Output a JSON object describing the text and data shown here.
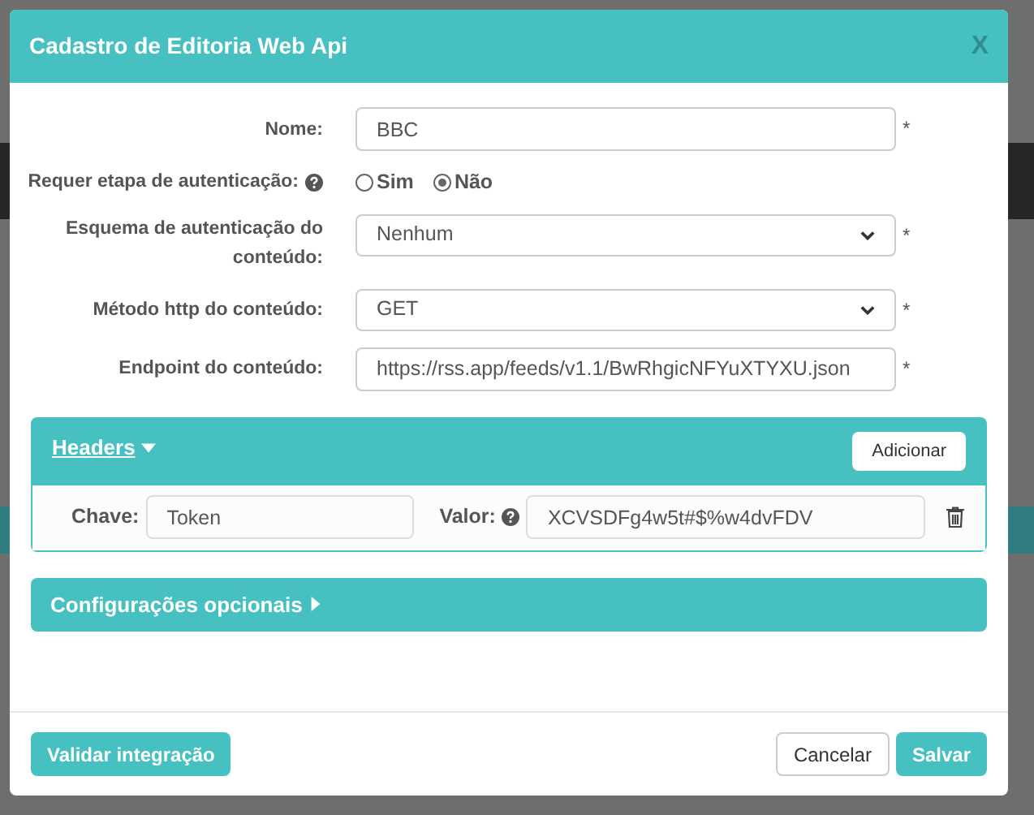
{
  "modal": {
    "title": "Cadastro de Editoria Web Api",
    "close": "X"
  },
  "fields": [
    {
      "kind": "text",
      "label": "Nome:",
      "value": "BBC",
      "required": "*"
    },
    {
      "kind": "radio",
      "label": "Requer etapa de autenticação:",
      "help": true,
      "options": [
        {
          "label": "Sim",
          "selected": false
        },
        {
          "label": "Não",
          "selected": true
        }
      ]
    },
    {
      "kind": "select",
      "label": "Esquema de autenticação do conteúdo:",
      "value": "Nenhum",
      "required": "*"
    },
    {
      "kind": "select",
      "label": "Método http do conteúdo:",
      "value": "GET",
      "required": "*"
    },
    {
      "kind": "text",
      "label": "Endpoint do conteúdo:",
      "value": "https://rss.app/feeds/v1.1/BwRhgicNFYuXTYXU.json",
      "required": "*"
    }
  ],
  "headers_panel": {
    "title": "Headers",
    "expanded": true,
    "add_button": "Adicionar",
    "rows": [
      {
        "key_label": "Chave:",
        "key": "Token",
        "value_label": "Valor:",
        "value": "XCVSDFg4w5t#$%w4dvFDV"
      }
    ]
  },
  "optional_panel": {
    "title": "Configurações opcionais",
    "expanded": false
  },
  "footer": {
    "validate": "Validar integração",
    "cancel": "Cancelar",
    "save": "Salvar"
  }
}
